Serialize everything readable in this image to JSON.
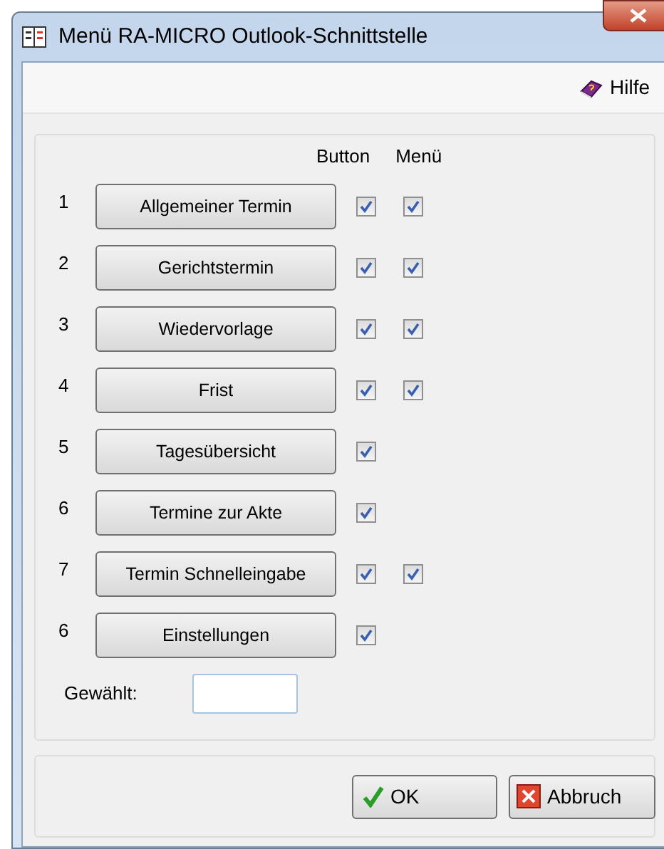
{
  "window": {
    "title": "Menü RA-MICRO Outlook-Schnittstelle"
  },
  "toolbar": {
    "help": "Hilfe"
  },
  "columns": [
    "Button",
    "Menü"
  ],
  "rows": [
    {
      "number": "1",
      "label": "Allgemeiner Termin",
      "button_checked": true,
      "menu": {
        "checked": true
      }
    },
    {
      "number": "2",
      "label": "Gerichtstermin",
      "button_checked": true,
      "menu": {
        "checked": true
      }
    },
    {
      "number": "3",
      "label": "Wiedervorlage",
      "button_checked": true,
      "menu": {
        "checked": true
      }
    },
    {
      "number": "4",
      "label": "Frist",
      "button_checked": true,
      "menu": {
        "checked": true
      }
    },
    {
      "number": "5",
      "label": "Tagesübersicht",
      "button_checked": true
    },
    {
      "number": "6",
      "label": "Termine zur Akte",
      "button_checked": true
    },
    {
      "number": "7",
      "label": "Termin Schnelleingabe",
      "button_checked": true,
      "menu": {
        "checked": true
      }
    },
    {
      "number": "6",
      "label": "Einstellungen",
      "button_checked": true
    }
  ],
  "selected_field": {
    "label": "Gewählt:"
  },
  "buttons": {
    "ok": "OK",
    "cancel": "Abbruch"
  }
}
